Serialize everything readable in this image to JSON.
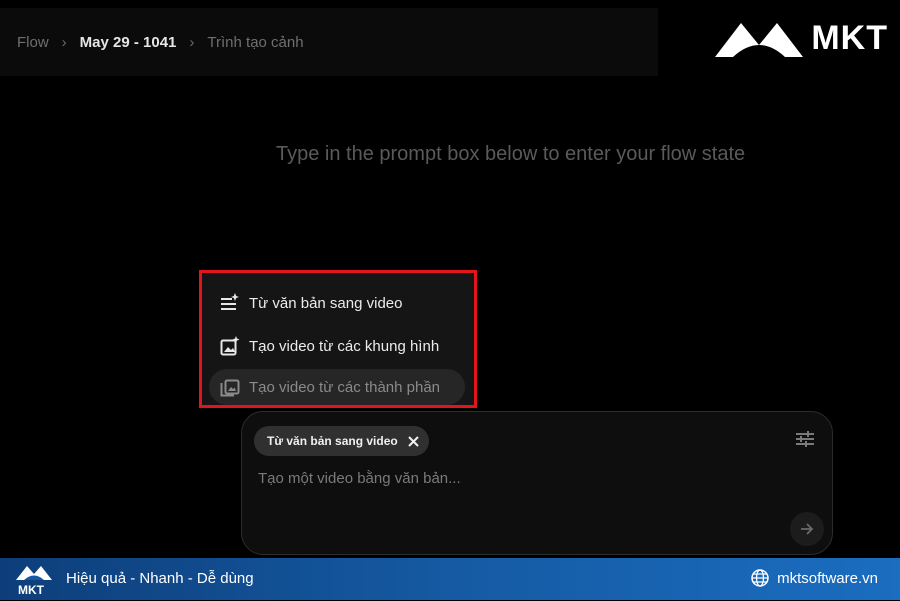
{
  "breadcrumb": {
    "root": "Flow",
    "project": "May 29 - 1041",
    "page": "Trình tạo cảnh"
  },
  "brand": {
    "logo_text": "MKT"
  },
  "hint": "Type in the prompt box below to enter your flow state",
  "mode_menu": {
    "items": [
      {
        "label": "Từ văn bản sang video",
        "icon": "text-sparkle-icon"
      },
      {
        "label": "Tạo video từ các khung hình",
        "icon": "image-sparkle-icon"
      },
      {
        "label": "Tạo video từ các thành phần",
        "icon": "layers-sparkle-icon"
      }
    ],
    "highlight_color": "#e3141b"
  },
  "prompt": {
    "mode_chip": "Từ văn bản sang video",
    "placeholder": "Tạo một video bằng văn bản...",
    "settings_icon": "tune-icon",
    "send_icon": "arrow-right-icon"
  },
  "footer": {
    "logo_text": "MKT",
    "tagline": "Hiệu quả - Nhanh - Dễ dùng",
    "website": "mktsoftware.vn"
  }
}
